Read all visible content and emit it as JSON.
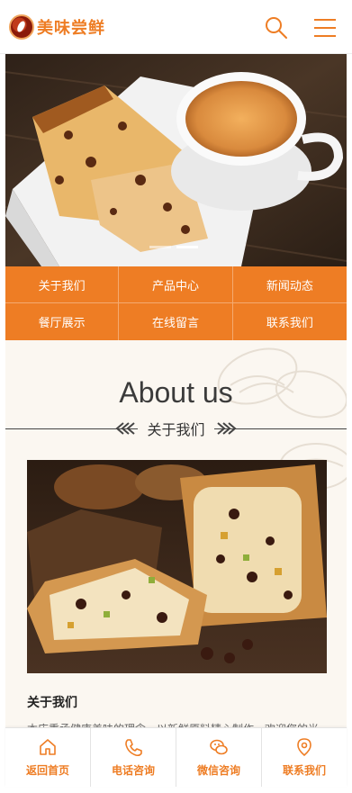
{
  "header": {
    "brand": "美味尝鲜",
    "search_icon": "search-icon",
    "menu_icon": "menu-icon"
  },
  "banner": {
    "slides": 2,
    "active_slide": 2
  },
  "nav": {
    "items": [
      {
        "label": "关于我们"
      },
      {
        "label": "产品中心"
      },
      {
        "label": "新闻动态"
      },
      {
        "label": "餐厅展示"
      },
      {
        "label": "在线留言"
      },
      {
        "label": "联系我们"
      }
    ]
  },
  "about": {
    "title": "About us",
    "subtitle": "关于我们",
    "heading": "关于我们",
    "body": "本店秉承健康美味的理念，以新鲜原料精心制作，欢迎您的光临。"
  },
  "footer": {
    "items": [
      {
        "label": "返回首页",
        "icon": "home-icon"
      },
      {
        "label": "电话咨询",
        "icon": "phone-icon"
      },
      {
        "label": "微信咨询",
        "icon": "wechat-icon"
      },
      {
        "label": "联系我们",
        "icon": "location-icon"
      }
    ]
  },
  "colors": {
    "accent": "#ee7d24",
    "section_bg": "#fbf7f1"
  }
}
